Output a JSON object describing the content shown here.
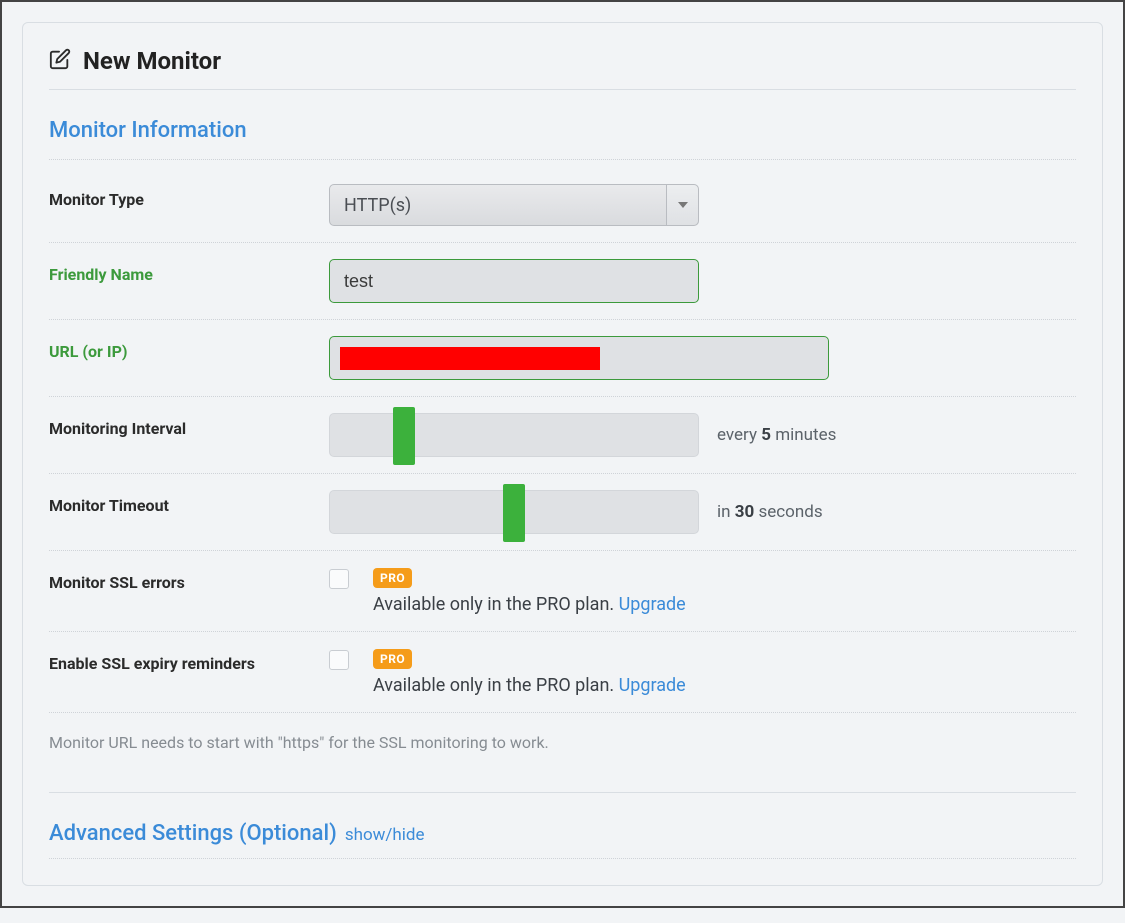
{
  "header": {
    "title": "New Monitor"
  },
  "section_info_title": "Monitor Information",
  "fields": {
    "monitor_type": {
      "label": "Monitor Type",
      "value": "HTTP(s)"
    },
    "friendly_name": {
      "label": "Friendly Name",
      "value": "test"
    },
    "url": {
      "label": "URL (or IP)"
    },
    "interval": {
      "label": "Monitoring Interval",
      "caption_prefix": "every ",
      "value": "5",
      "caption_suffix": " minutes",
      "handle_percent": 17
    },
    "timeout": {
      "label": "Monitor Timeout",
      "caption_prefix": "in ",
      "value": "30",
      "caption_suffix": " seconds",
      "handle_percent": 47
    },
    "ssl_errors": {
      "label": "Monitor SSL errors",
      "badge": "PRO",
      "note": "Available only in the PRO plan. ",
      "upgrade": "Upgrade"
    },
    "ssl_expiry": {
      "label": "Enable SSL expiry reminders",
      "badge": "PRO",
      "note": "Available only in the PRO plan. ",
      "upgrade": "Upgrade"
    }
  },
  "hint": "Monitor URL needs to start with \"https\" for the SSL monitoring to work.",
  "advanced": {
    "title": "Advanced Settings (Optional)",
    "toggle": "show/hide"
  }
}
